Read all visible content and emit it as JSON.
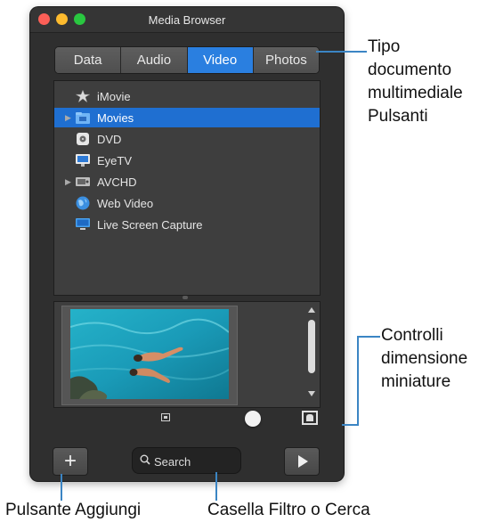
{
  "window": {
    "title": "Media Browser"
  },
  "tabs": [
    {
      "label": "Data"
    },
    {
      "label": "Audio"
    },
    {
      "label": "Video",
      "active": true
    },
    {
      "label": "Photos"
    }
  ],
  "sources": [
    {
      "label": "iMovie",
      "icon": "imovie-star-icon"
    },
    {
      "label": "Movies",
      "icon": "movies-folder-icon",
      "expandable": true,
      "selected": true
    },
    {
      "label": "DVD",
      "icon": "dvd-icon"
    },
    {
      "label": "EyeTV",
      "icon": "eyetv-icon"
    },
    {
      "label": "AVCHD",
      "icon": "avchd-icon",
      "expandable": true
    },
    {
      "label": "Web Video",
      "icon": "globe-icon"
    },
    {
      "label": "Live Screen Capture",
      "icon": "screen-capture-icon"
    }
  ],
  "thumbnail": {
    "icon": "swimmers-thumbnail"
  },
  "search": {
    "placeholder": "Search"
  },
  "callouts": {
    "media_type": {
      "line1": "Tipo",
      "line2": "documento",
      "line3": "multimediale",
      "line4": "Pulsanti"
    },
    "thumb_size": {
      "line1": "Controlli",
      "line2": "dimensione",
      "line3": "miniature"
    },
    "add": "Pulsante Aggiungi",
    "filter": "Casella Filtro o Cerca"
  },
  "colors": {
    "accent": "#2a7fe0",
    "callout_line": "#3b85c4",
    "window_bg": "#2f2f2f"
  }
}
